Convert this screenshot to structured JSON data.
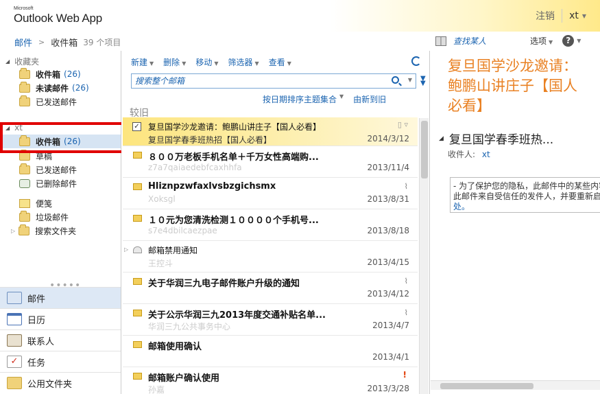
{
  "app": {
    "brand_small": "Microsoft",
    "brand_name": "Outlook Web App"
  },
  "header": {
    "signout": "注销",
    "user": "xt"
  },
  "breadcrumb": {
    "root": "邮件",
    "folder": "收件箱",
    "count": "39 个项目"
  },
  "header_right": {
    "find_people": "查找某人",
    "options": "选项",
    "help": "?"
  },
  "sidebar": {
    "favorites": {
      "label": "收藏夹",
      "items": [
        {
          "label": "收件箱",
          "count": "(26)",
          "bold": true
        },
        {
          "label": "未读邮件",
          "count": "(26)",
          "bold": true
        },
        {
          "label": "已发送邮件",
          "count": "",
          "bold": false
        }
      ]
    },
    "mailbox": {
      "label": "xt",
      "items": [
        {
          "label": "收件箱",
          "count": "(26)"
        },
        {
          "label": "草稿"
        },
        {
          "label": "已发送邮件"
        },
        {
          "label": "已删除邮件"
        },
        {
          "label": "便笺"
        },
        {
          "label": "垃圾邮件"
        },
        {
          "label": "搜索文件夹"
        }
      ]
    },
    "modules": [
      "邮件",
      "日历",
      "联系人",
      "任务",
      "公用文件夹"
    ]
  },
  "toolbar": {
    "new": "新建",
    "delete": "删除",
    "move": "移动",
    "filter": "筛选器",
    "view": "查看"
  },
  "search": {
    "placeholder": "搜索整个邮箱"
  },
  "sort": {
    "by": "按日期排序主题集合",
    "order": "由新到旧"
  },
  "group_label": "较旧",
  "messages": [
    {
      "subject": "复旦国学沙龙邀请：鲍鹏山讲庄子【国人必看】",
      "from": "复旦国学春季班热招【国人必看】",
      "date": "2014/3/12"
    },
    {
      "subject": "８００万老板手机名单＋千万女性高端购...",
      "from": "z7a7qaiaedebfcaxhhfa",
      "date": "2013/11/4"
    },
    {
      "subject": "Hliznpzwfaxlvsbzgichsmx",
      "from": "Xoksgl",
      "date": "2013/8/31"
    },
    {
      "subject": "１０元为您清洗检测１００００个手机号...",
      "from": "s7e4dbilcaezpae",
      "date": "2013/8/18"
    },
    {
      "subject": "邮箱禁用通知",
      "from": "王控斗",
      "date": "2013/4/15"
    },
    {
      "subject": "关于华润三九电子邮件账户升级的通知",
      "from": "",
      "date": "2013/4/12"
    },
    {
      "subject": "关于公示华润三九2013年度交通补贴名单...",
      "from": "华润三九公共事务中心",
      "date": "2013/4/7"
    },
    {
      "subject": "邮箱使用确认",
      "from": "",
      "date": "2013/4/1"
    },
    {
      "subject": "邮箱账户确认使用",
      "from": "孙嘉",
      "date": "2013/3/28"
    }
  ],
  "reading": {
    "title": "复旦国学沙龙邀请：鲍鹏山讲庄子【国人必看】",
    "thread": "复旦国学春季班热...",
    "to_label": "收件人:",
    "to_value": "xt",
    "notice1": "- 为了保护您的隐私，此邮件中的某些内容",
    "notice2": "此邮件来自受信任的发件人，并要重新启",
    "notice3": "处。"
  },
  "colors": {
    "accent": "#1b64b0",
    "title_orange": "#e98123",
    "highlight": "#fde57e",
    "annotation_red": "#e00000"
  }
}
